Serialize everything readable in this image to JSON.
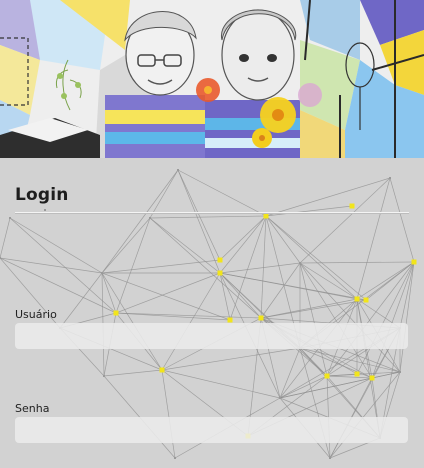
{
  "form": {
    "title": "Login",
    "username_label": "Usuário",
    "username_value": "",
    "username_placeholder": "",
    "password_label": "Senha",
    "password_value": "",
    "password_placeholder": ""
  },
  "banner": {
    "description_icon": "children-illustration",
    "accent_colors": [
      "#f3d63b",
      "#7d6fcc",
      "#59b6e8",
      "#e95a2c",
      "#9fd37a"
    ]
  },
  "background": {
    "icon": "network-graph",
    "node_color": "#f2e51a",
    "edge_color": "#8e8e8e"
  }
}
